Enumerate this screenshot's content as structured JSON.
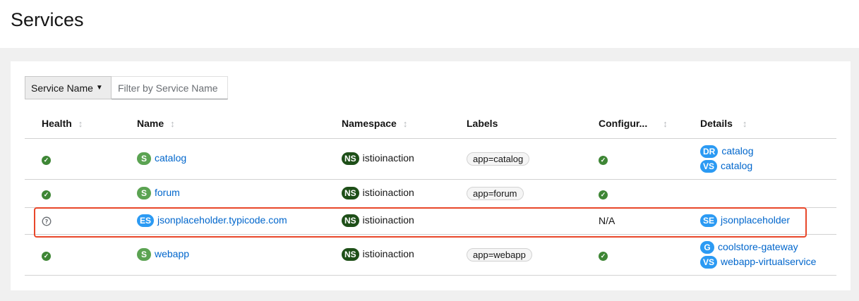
{
  "page": {
    "title": "Services"
  },
  "toolbar": {
    "filter_type": "Service Name",
    "filter_placeholder": "Filter by Service Name"
  },
  "table": {
    "headers": {
      "health": "Health",
      "name": "Name",
      "namespace": "Namespace",
      "labels": "Labels",
      "configuration": "Configur...",
      "details": "Details"
    },
    "rows": [
      {
        "health": "healthy",
        "badge": "S",
        "name": "catalog",
        "ns_badge": "NS",
        "namespace": "istioinaction",
        "label": "app=catalog",
        "config": "valid",
        "details": [
          {
            "badge": "DR",
            "name": "catalog"
          },
          {
            "badge": "VS",
            "name": "catalog"
          }
        ]
      },
      {
        "health": "healthy",
        "badge": "S",
        "name": "forum",
        "ns_badge": "NS",
        "namespace": "istioinaction",
        "label": "app=forum",
        "config": "valid",
        "details": []
      },
      {
        "health": "unknown",
        "badge": "ES",
        "name": "jsonplaceholder.typicode.com",
        "ns_badge": "NS",
        "namespace": "istioinaction",
        "label": "",
        "config_text": "N/A",
        "details": [
          {
            "badge": "SE",
            "name": "jsonplaceholder"
          }
        ]
      },
      {
        "health": "healthy",
        "badge": "S",
        "name": "webapp",
        "ns_badge": "NS",
        "namespace": "istioinaction",
        "label": "app=webapp",
        "config": "valid",
        "details": [
          {
            "badge": "G",
            "name": "coolstore-gateway"
          },
          {
            "badge": "VS",
            "name": "webapp-virtualservice"
          }
        ]
      }
    ]
  },
  "colors": {
    "link": "#0066cc",
    "healthy": "#3e8635",
    "service_badge": "#5ba352",
    "info_badge": "#2b9af3",
    "namespace_badge": "#1e4f18",
    "highlight": "#e8472a"
  }
}
